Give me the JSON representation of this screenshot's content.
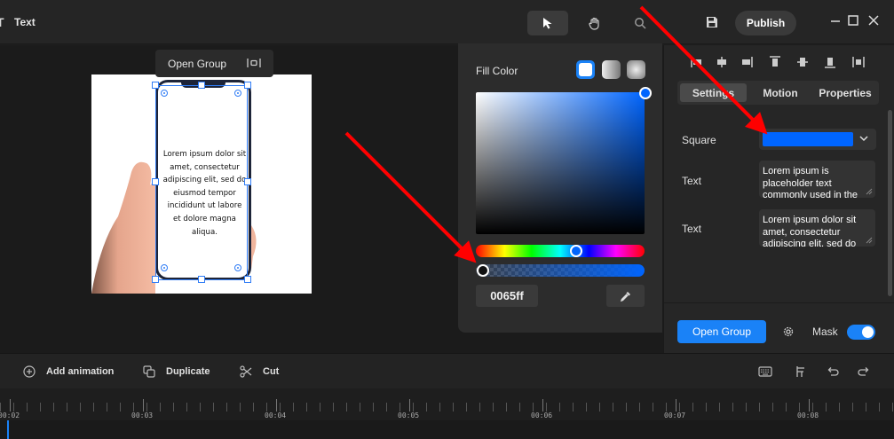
{
  "app": {
    "title": "Text",
    "publish_label": "Publish"
  },
  "canvas": {
    "open_group_label": "Open Group",
    "phone_text": "Lorem ipsum dolor sit amet, consectetur adipiscing elit, sed do eiusmod tempor incididunt ut labore et dolore magna aliqua."
  },
  "fill": {
    "title": "Fill Color",
    "hex": "0065ff",
    "color": "#0065ff"
  },
  "panel": {
    "tabs": [
      {
        "label": "Settings",
        "active": true
      },
      {
        "label": "Motion",
        "active": false
      },
      {
        "label": "Properties",
        "active": false
      }
    ],
    "square_label": "Square",
    "square_color": "#0065ff",
    "text1_label": "Text",
    "text1_value": "Lorem ipsum is placeholder text commonly used in the",
    "text2_label": "Text",
    "text2_value": "Lorem ipsum dolor sit amet, consectetur adipiscing elit, sed do",
    "open_group_label": "Open Group",
    "mask_label": "Mask",
    "mask_on": true
  },
  "toolbar": {
    "add_animation": "Add animation",
    "duplicate": "Duplicate",
    "cut": "Cut"
  },
  "timeline": {
    "ticks": [
      "00:02",
      "00:03",
      "00:04",
      "00:05",
      "00:06",
      "00:07",
      "00:08"
    ]
  },
  "colors": {
    "accent": "#1a82f7",
    "annotation_arrow": "#ff0000"
  }
}
